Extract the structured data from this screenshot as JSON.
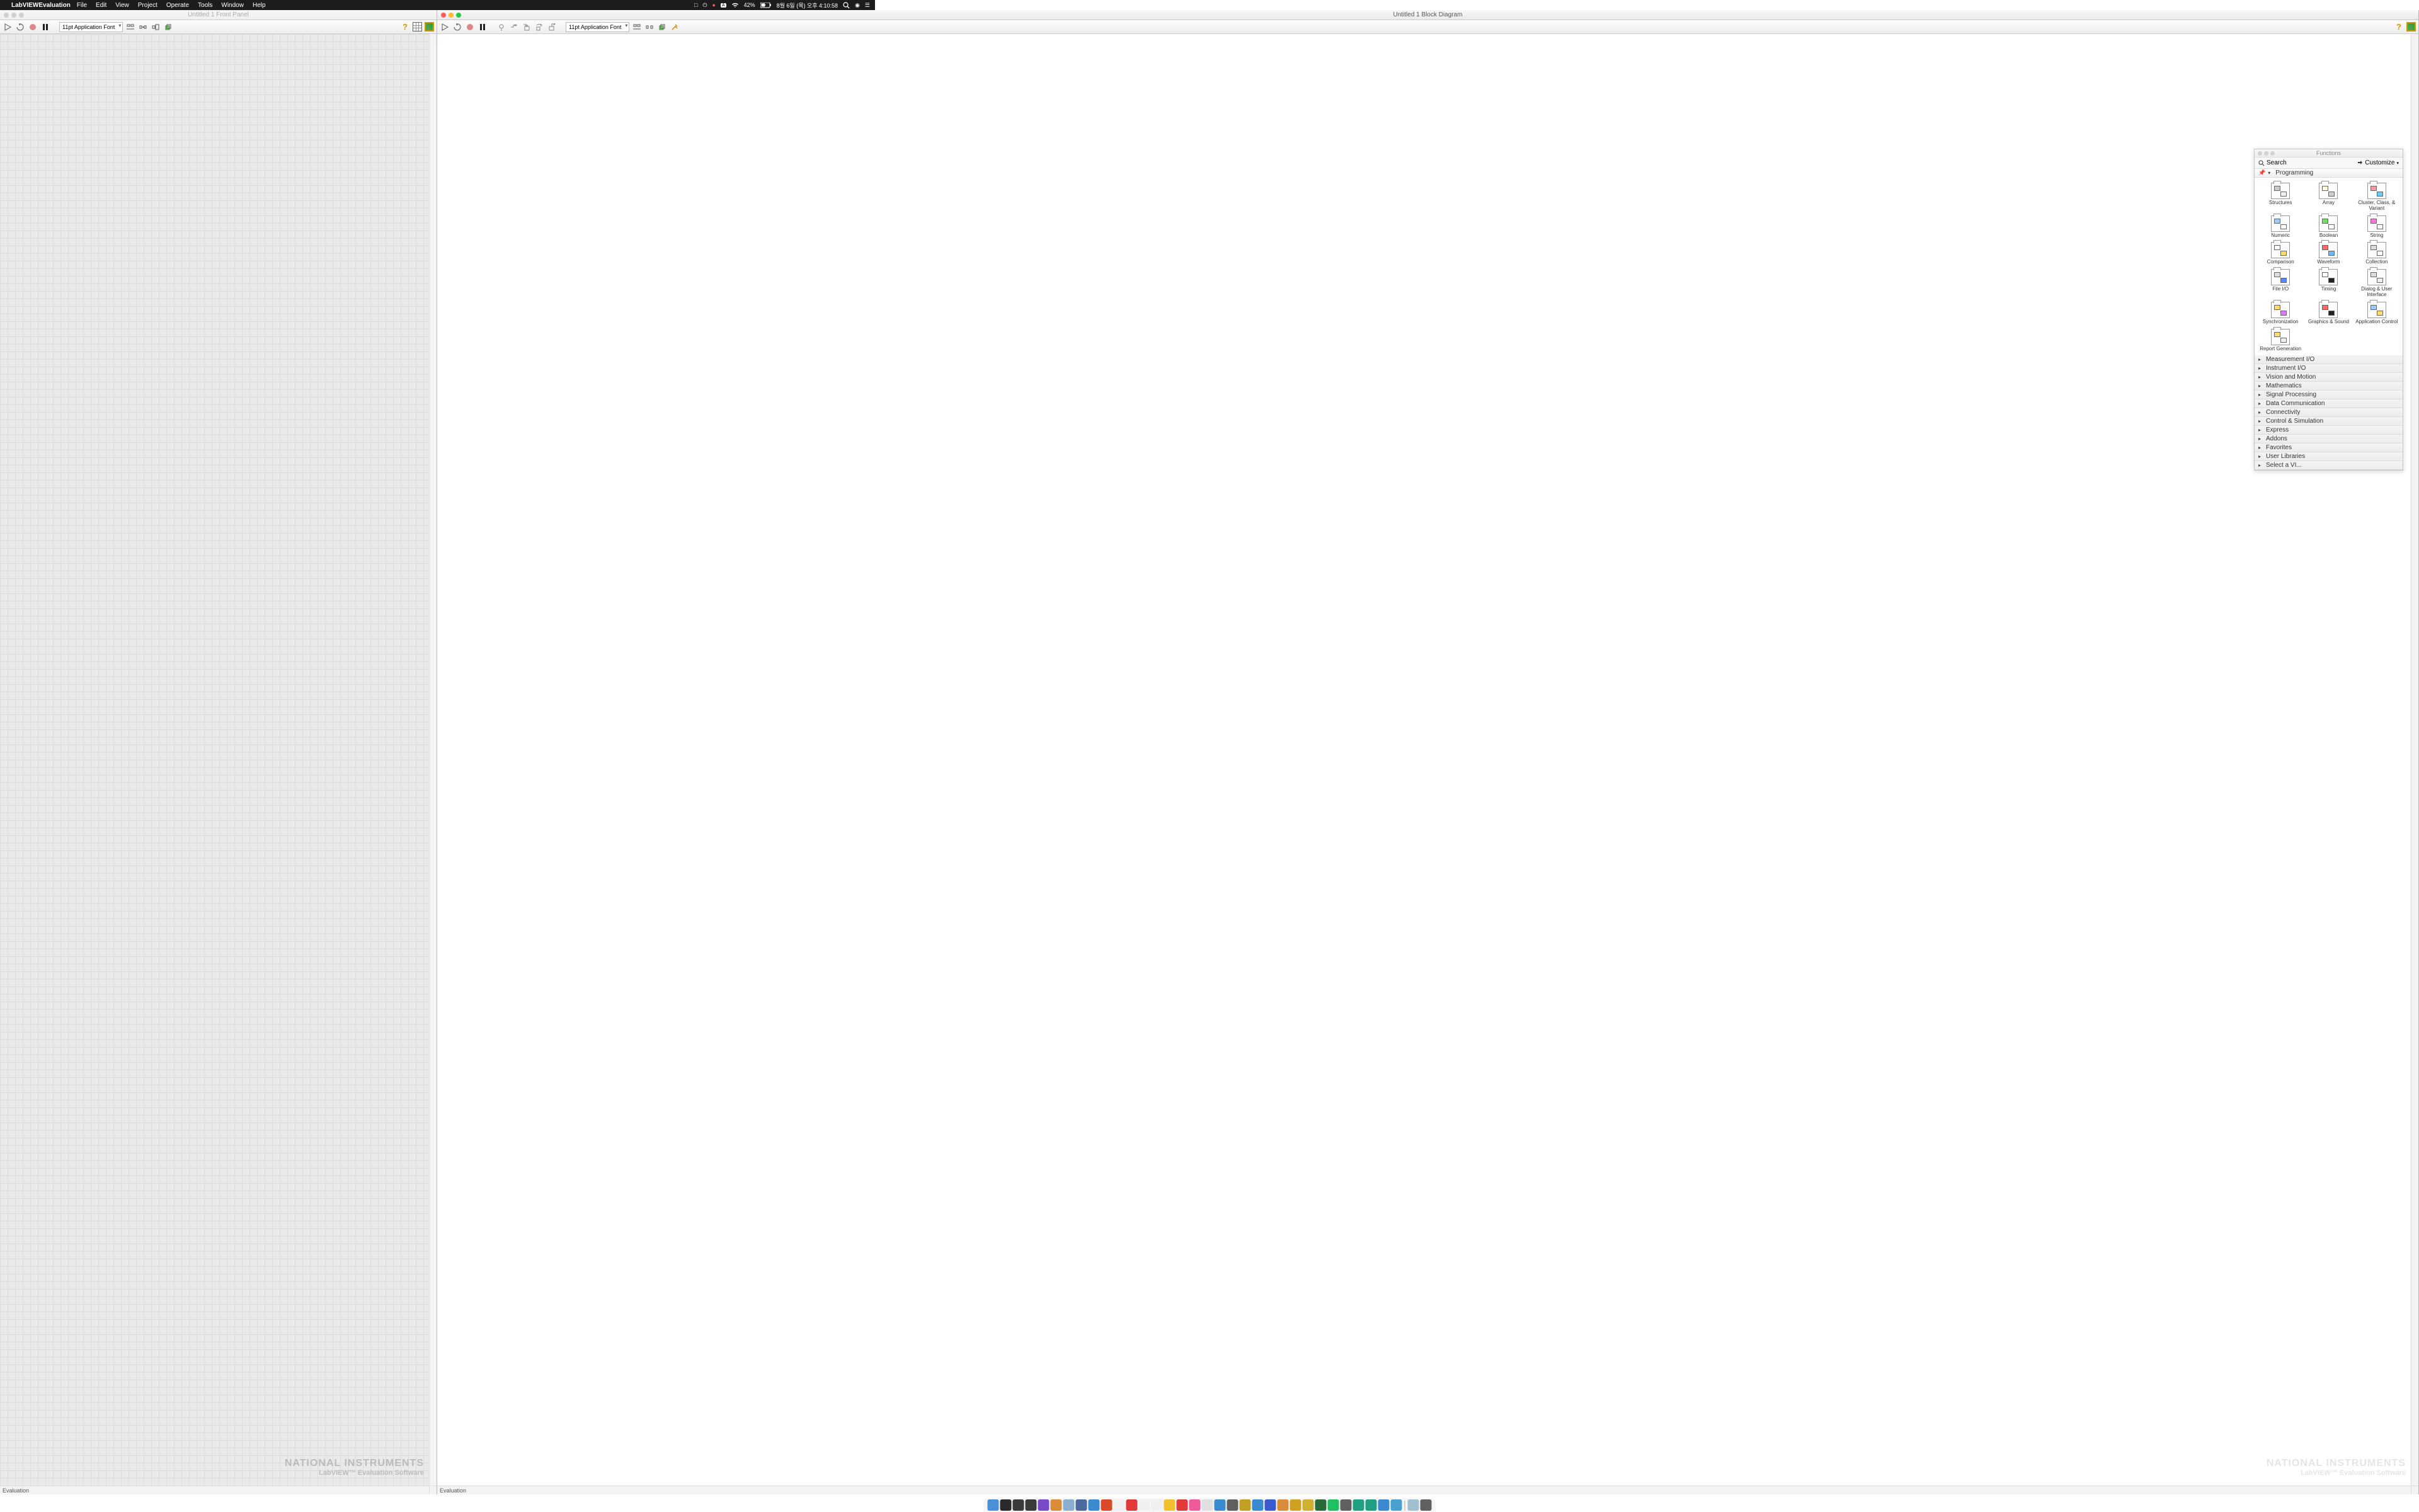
{
  "menubar": {
    "app": "LabVIEWEvaluation",
    "items": [
      "File",
      "Edit",
      "View",
      "Project",
      "Operate",
      "Tools",
      "Window",
      "Help"
    ],
    "battery": "42%",
    "datetime": "8월 6일 (목) 오후 4:10:58"
  },
  "front_panel": {
    "title": "Untitled 1 Front Panel",
    "font": "11pt Application Font",
    "status": "Evaluation"
  },
  "block_diagram": {
    "title": "Untitled 1 Block Diagram",
    "font": "11pt Application Font",
    "status": "Evaluation"
  },
  "watermark": {
    "l1": "NATIONAL INSTRUMENTS",
    "l2": "LabVIEW™ Evaluation Software"
  },
  "palette": {
    "title": "Functions",
    "search": "Search",
    "customize": "Customize",
    "open_cat": "Programming",
    "items": [
      {
        "label": "Structures",
        "c1": "#ccc",
        "c2": "#eee"
      },
      {
        "label": "Array",
        "c1": "#ffd",
        "c2": "#ccc"
      },
      {
        "label": "Cluster, Class, & Variant",
        "c1": "#f9a",
        "c2": "#6cf"
      },
      {
        "label": "Numeric",
        "c1": "#9cf",
        "c2": "#fff"
      },
      {
        "label": "Boolean",
        "c1": "#7d6",
        "c2": "#fff"
      },
      {
        "label": "String",
        "c1": "#f7d",
        "c2": "#fff"
      },
      {
        "label": "Comparison",
        "c1": "#fff",
        "c2": "#fd6"
      },
      {
        "label": "Waveform",
        "c1": "#f66",
        "c2": "#6bf"
      },
      {
        "label": "Collection",
        "c1": "#ddd",
        "c2": "#fff"
      },
      {
        "label": "File I/O",
        "c1": "#ddd",
        "c2": "#58f"
      },
      {
        "label": "Timing",
        "c1": "#fff",
        "c2": "#222"
      },
      {
        "label": "Dialog & User Interface",
        "c1": "#ddd",
        "c2": "#eee"
      },
      {
        "label": "Synchronization",
        "c1": "#fd6",
        "c2": "#d7f"
      },
      {
        "label": "Graphics & Sound",
        "c1": "#f66",
        "c2": "#222"
      },
      {
        "label": "Application Control",
        "c1": "#9cf",
        "c2": "#fd6"
      },
      {
        "label": "Report Generation",
        "c1": "#fd6",
        "c2": "#eee"
      }
    ],
    "closed_cats": [
      "Measurement I/O",
      "Instrument I/O",
      "Vision and Motion",
      "Mathematics",
      "Signal Processing",
      "Data Communication",
      "Connectivity",
      "Control & Simulation",
      "Express",
      "Addons",
      "Favorites",
      "User Libraries",
      "Select a VI..."
    ]
  },
  "dock": {
    "colors": [
      "#4a90d9",
      "#2a2a2a",
      "#3a3a3a",
      "#3a3a3a",
      "#7a49c9",
      "#d98c3a",
      "#8ab0d0",
      "#4a6aa0",
      "#3a8ad0",
      "#d94a2a",
      "#f0f0f0",
      "#e03a3a",
      "#f0f0f0",
      "#f0f0f0",
      "#f0c030",
      "#e03a3a",
      "#f05a9a",
      "#e0e0e0",
      "#3a8ad0",
      "#606060",
      "#c0a020",
      "#3a8ad0",
      "#3a5ad0",
      "#d98c3a",
      "#d0a020",
      "#d0b030",
      "#2a6a3a",
      "#20c060",
      "#606060",
      "#20a080",
      "#20a080",
      "#3a8ad0",
      "#4aa0d0",
      "#a0c0d0",
      "#606060"
    ]
  }
}
